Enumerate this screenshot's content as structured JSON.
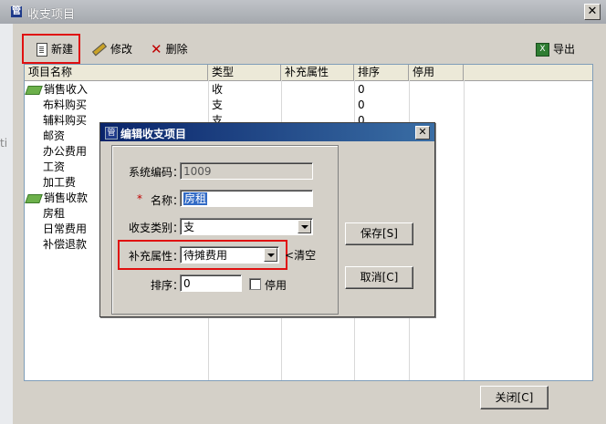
{
  "window": {
    "title": "收支项目",
    "close_glyph": "✕",
    "left_edge_text": "ti"
  },
  "toolbar": {
    "new_label": "新建",
    "edit_label": "修改",
    "delete_label": "删除",
    "export_label": "导出"
  },
  "table": {
    "columns": [
      "项目名称",
      "类型",
      "补充属性",
      "排序",
      "停用"
    ],
    "rows": [
      {
        "name": "销售收入",
        "type": "收",
        "extra": "",
        "order": "0",
        "icon": "leaf-icon"
      },
      {
        "name": "布料购买",
        "type": "支",
        "extra": "",
        "order": "0"
      },
      {
        "name": "辅料购买",
        "type": "支",
        "extra": "",
        "order": "0"
      },
      {
        "name": "邮资",
        "type": "",
        "extra": "",
        "order": ""
      },
      {
        "name": "办公费用",
        "type": "",
        "extra": "",
        "order": ""
      },
      {
        "name": "工资",
        "type": "",
        "extra": "",
        "order": ""
      },
      {
        "name": "加工费",
        "type": "",
        "extra": "",
        "order": ""
      },
      {
        "name": "销售收款",
        "type": "",
        "extra": "",
        "order": "",
        "icon": "leaf-icon"
      },
      {
        "name": "房租",
        "type": "",
        "extra": "",
        "order": ""
      },
      {
        "name": "日常费用",
        "type": "",
        "extra": "",
        "order": ""
      },
      {
        "name": "补偿退款",
        "type": "",
        "extra": "",
        "order": ""
      }
    ]
  },
  "dialog": {
    "title": "编辑收支项目",
    "close_glyph": "✕",
    "code_label": "系统编码：",
    "code_value": "1009",
    "required_mark": "*",
    "name_label": "名称：",
    "name_value": "房租",
    "category_label": "收支类别：",
    "category_value": "支",
    "extra_label": "补充属性：",
    "extra_value": "待摊费用",
    "clear_label": "清空",
    "order_label": "排序：",
    "order_value": "0",
    "disable_label": "停用",
    "save_button": "保存[S]",
    "cancel_button": "取消[C]"
  },
  "footer": {
    "close_button": "关闭[C]"
  },
  "colors": {
    "highlight_border": "#e01010",
    "dialog_title": "#0a246a",
    "selection": "#316ac5"
  }
}
